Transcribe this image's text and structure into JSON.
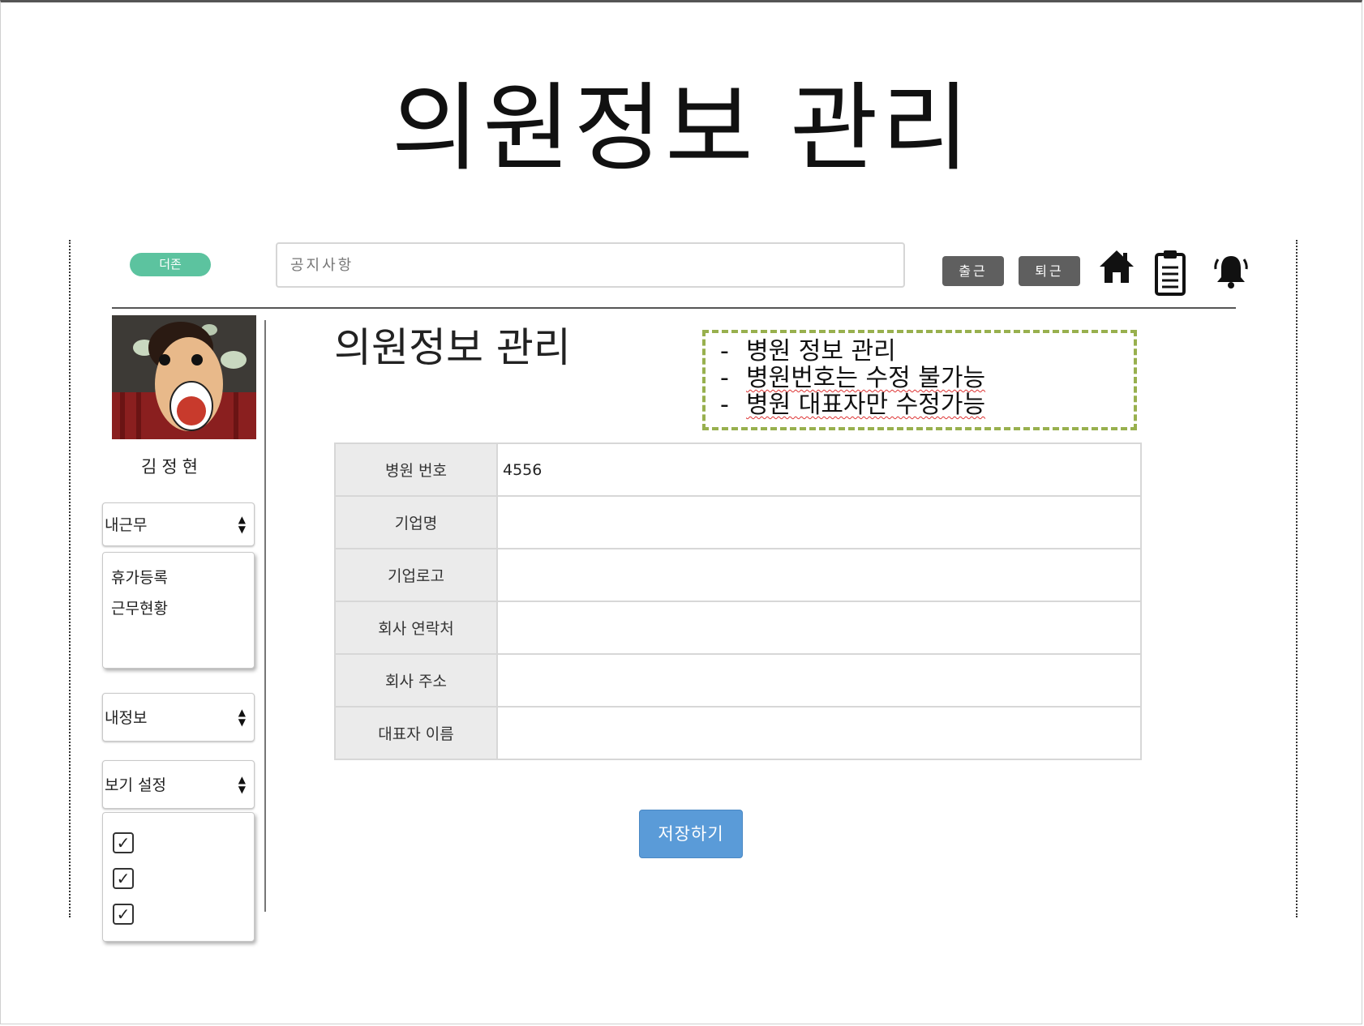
{
  "slide": {
    "title": "의원정보 관리"
  },
  "topbar": {
    "brand": "더존",
    "notice_placeholder": "공지사항",
    "checkin_label": "출근",
    "checkout_label": "퇴근",
    "icons": [
      "home-icon",
      "clipboard-icon",
      "bell-icon"
    ]
  },
  "sidebar": {
    "user_name": "김정현",
    "work_select": {
      "selected": "내근무",
      "items": [
        "휴가등록",
        "근무현황"
      ]
    },
    "info_select": {
      "selected": "내정보"
    },
    "view_select": {
      "selected": "보기 설정",
      "checkbox_count": 3
    }
  },
  "main": {
    "title": "의원정보 관리",
    "notes": [
      "병원 정보 관리",
      "병원번호는 수정 불가능",
      "병원 대표자만 수정가능"
    ],
    "fields": [
      {
        "label": "병원 번호",
        "value": "4556"
      },
      {
        "label": "기업명",
        "value": ""
      },
      {
        "label": "기업로고",
        "value": ""
      },
      {
        "label": "회사 연락처",
        "value": ""
      },
      {
        "label": "회사 주소",
        "value": ""
      },
      {
        "label": "대표자 이름",
        "value": ""
      }
    ],
    "save_label": "저장하기"
  },
  "colors": {
    "brand": "#5cc39f",
    "dark_button": "#5f5f5f",
    "save_button": "#5a9bd8",
    "note_border": "#98b04e",
    "label_cell": "#ebebeb"
  }
}
